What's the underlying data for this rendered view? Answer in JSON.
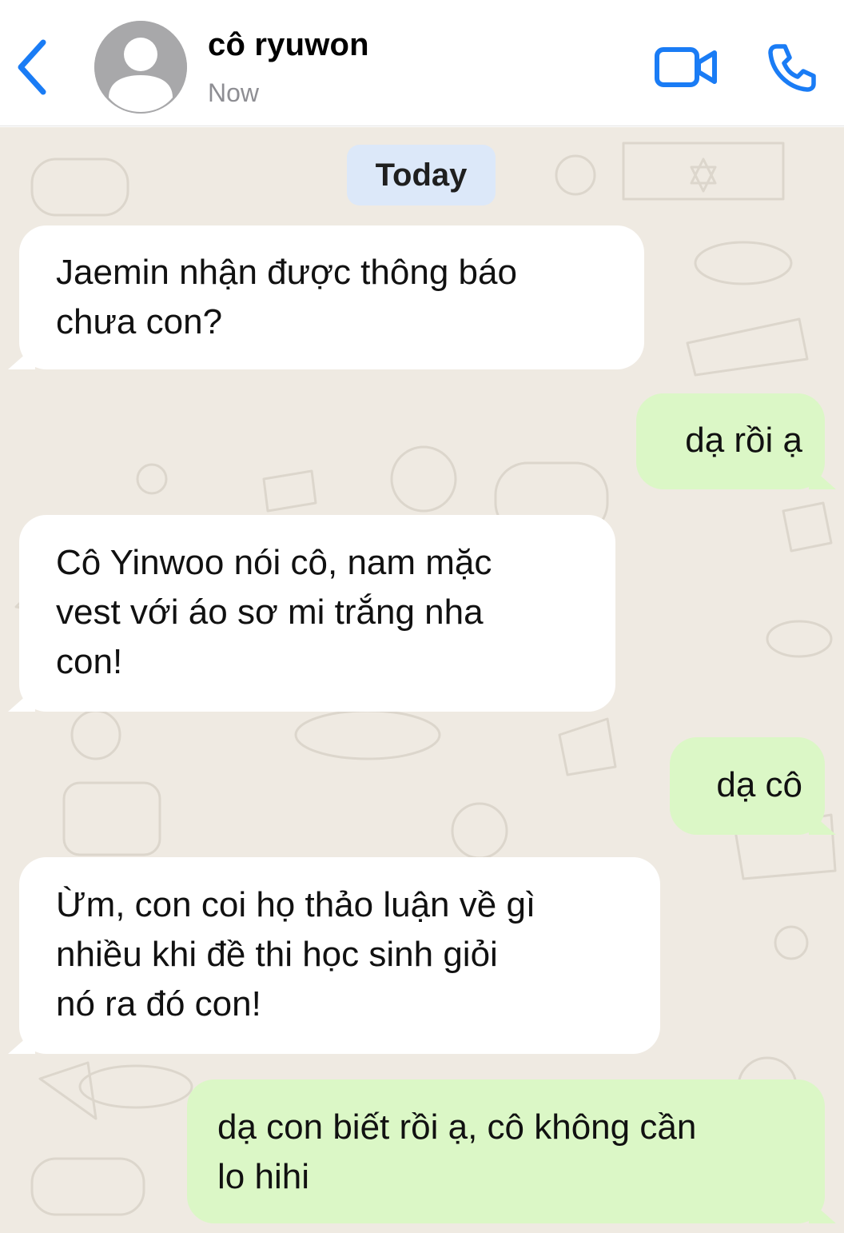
{
  "header": {
    "contact_name": "cô ryuwon",
    "status": "Now",
    "back_icon": "chevron-left-icon",
    "avatar_icon": "person-silhouette-icon",
    "video_icon": "video-camera-icon",
    "call_icon": "phone-icon",
    "accent_color": "#1a7cf5"
  },
  "chat": {
    "day_label": "Today",
    "background_color": "#efeae2",
    "incoming_bubble_color": "#ffffff",
    "outgoing_bubble_color": "#dbf7c6",
    "messages": [
      {
        "direction": "incoming",
        "text": "Jaemin nhận được thông báo\nchưa con?"
      },
      {
        "direction": "outgoing",
        "text": "dạ rồi ạ"
      },
      {
        "direction": "incoming",
        "text": "Cô Yinwoo nói cô, nam mặc\nvest với áo sơ mi trắng nha\ncon!"
      },
      {
        "direction": "outgoing",
        "text": "dạ cô"
      },
      {
        "direction": "incoming",
        "text": "Ừm, con coi họ thảo luận về gì\nnhiều khi đề thi học sinh giỏi\nnó ra đó con!"
      },
      {
        "direction": "outgoing",
        "text": "dạ con biết rồi ạ, cô không cần\nlo hihi"
      }
    ]
  }
}
